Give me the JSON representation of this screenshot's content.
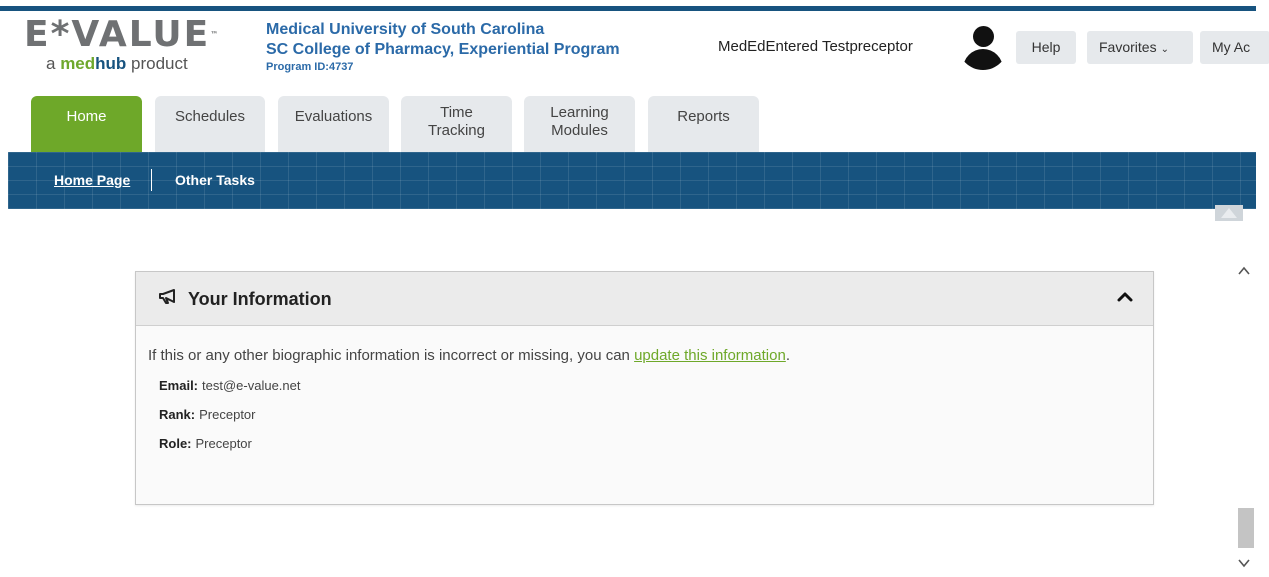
{
  "logo": {
    "main": "E*VALUE",
    "tm": "™",
    "sub_prefix": "a ",
    "sub_brand_med": "med",
    "sub_brand_hub": "hub",
    "sub_suffix": " product"
  },
  "org": {
    "line1": "Medical University of South Carolina",
    "line2": "SC College of Pharmacy, Experiential Program",
    "line3": "Program ID:4737"
  },
  "user": {
    "name": "MedEdEntered Testpreceptor"
  },
  "header_buttons": {
    "help": "Help",
    "favorites": "Favorites",
    "my_account": "My Ac"
  },
  "tabs": [
    {
      "label": "Home",
      "active": true
    },
    {
      "label": "Schedules"
    },
    {
      "label": "Evaluations"
    },
    {
      "label_line1": "Time",
      "label_line2": "Tracking"
    },
    {
      "label_line1": "Learning",
      "label_line2": "Modules"
    },
    {
      "label": "Reports"
    }
  ],
  "subnav": {
    "home_page": "Home Page",
    "other_tasks": "Other Tasks"
  },
  "panel": {
    "title": "Your Information",
    "intro_text": "If this or any other biographic information is incorrect or missing, you can ",
    "intro_link": "update this information",
    "intro_end": ".",
    "fields": [
      {
        "key": "Email:",
        "value": "test@e-value.net"
      },
      {
        "key": "Rank:",
        "value": "Preceptor"
      },
      {
        "key": "Role:",
        "value": "Preceptor"
      }
    ]
  },
  "colors": {
    "brand_blue": "#17537f",
    "active_tab_green": "#6ea829",
    "link_green": "#6ea829",
    "org_blue": "#2b6aa8"
  }
}
